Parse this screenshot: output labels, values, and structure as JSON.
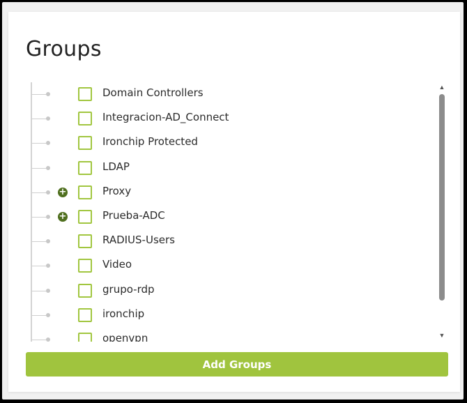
{
  "title": "Groups",
  "groups": [
    {
      "label": "Domain Controllers",
      "expandable": false
    },
    {
      "label": "Integracion-AD_Connect",
      "expandable": false
    },
    {
      "label": "Ironchip Protected",
      "expandable": false
    },
    {
      "label": "LDAP",
      "expandable": false
    },
    {
      "label": "Proxy",
      "expandable": true
    },
    {
      "label": "Prueba-ADC",
      "expandable": true
    },
    {
      "label": "RADIUS-Users",
      "expandable": false
    },
    {
      "label": "Video",
      "expandable": false
    },
    {
      "label": "grupo-rdp",
      "expandable": false
    },
    {
      "label": "ironchip",
      "expandable": false
    },
    {
      "label": "openvpn",
      "expandable": false
    }
  ],
  "add_button_label": "Add Groups",
  "colors": {
    "accent": "#a0c43e",
    "expand_icon": "#4f6f1e",
    "checkbox_border": "#a1c63f"
  },
  "icons": {
    "expand": "plus-circle-icon",
    "scroll_up": "triangle-up-icon",
    "scroll_down": "triangle-down-icon"
  }
}
